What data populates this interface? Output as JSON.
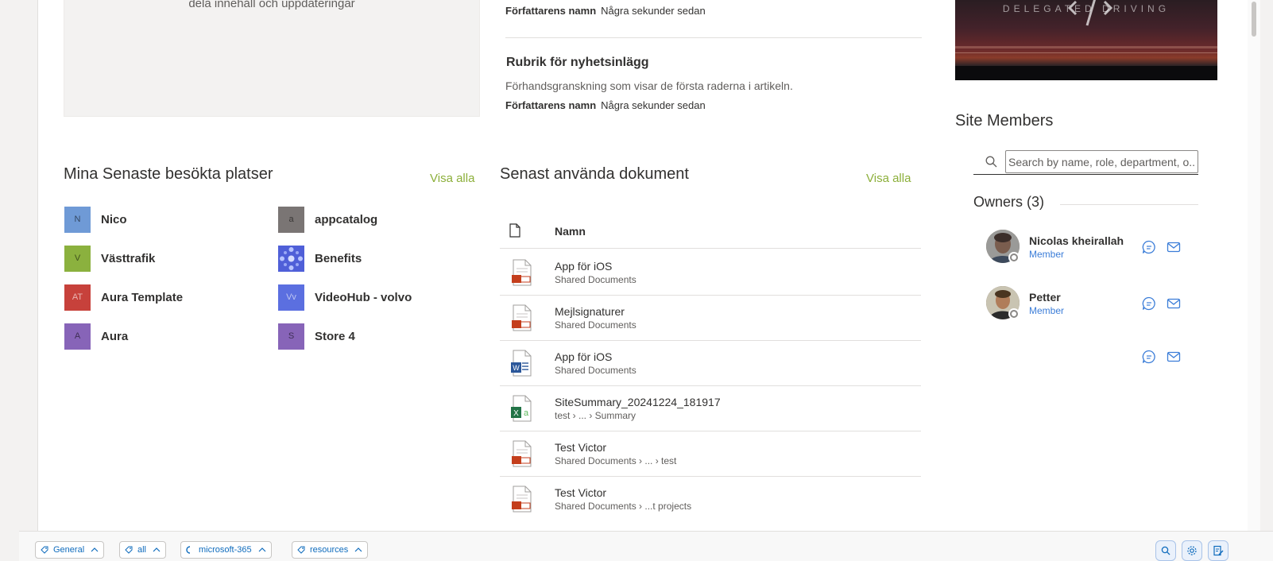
{
  "placeholder": {
    "text": "dela innehåll och uppdateringar"
  },
  "news": {
    "item1": {
      "author": "Författarens namn",
      "time": "Några sekunder sedan"
    },
    "item2": {
      "title": "Rubrik för nyhetsinlägg",
      "preview": "Förhandsgranskning som visar de första raderna i artikeln.",
      "author": "Författarens namn",
      "time": "Några sekunder sedan"
    }
  },
  "hero": {
    "text": "DELEGATED DRIVING"
  },
  "recent_sites": {
    "title": "Mina Senaste besökta platser",
    "see_all": "Visa alla",
    "items": [
      {
        "initials": "N",
        "name": "Nico",
        "color": "#6f9ad6"
      },
      {
        "initials": "a",
        "name": "appcatalog",
        "color": "#7a7574"
      },
      {
        "initials": "V",
        "name": "Västtrafik",
        "color": "#8bb13e"
      },
      {
        "initials": "",
        "name": "Benefits",
        "color": "#4f5fd8"
      },
      {
        "initials": "AT",
        "name": "Aura Template",
        "color": "#c7413b"
      },
      {
        "initials": "Vv",
        "name": "VideoHub - volvo",
        "color": "#5b6fe0"
      },
      {
        "initials": "A",
        "name": "Aura",
        "color": "#8764b8"
      },
      {
        "initials": "S",
        "name": "Store 4",
        "color": "#8764b8"
      }
    ]
  },
  "recent_docs": {
    "title": "Senast använda dokument",
    "see_all": "Visa alla",
    "column_name": "Namn",
    "rows": [
      {
        "name": "App för iOS",
        "path": "Shared Documents",
        "type": "ppt"
      },
      {
        "name": "Mejlsignaturer",
        "path": "Shared Documents",
        "type": "ppt"
      },
      {
        "name": "App för iOS",
        "path": "Shared Documents",
        "type": "word"
      },
      {
        "name": "SiteSummary_20241224_181917",
        "path": "test › ... › Summary",
        "type": "excel"
      },
      {
        "name": "Test Victor",
        "path": "Shared Documents › ... › test",
        "type": "ppt"
      },
      {
        "name": "Test Victor",
        "path": "Shared Documents › ...t projects",
        "type": "ppt"
      }
    ]
  },
  "members": {
    "title": "Site Members",
    "search_placeholder": "Search by name, role, department, o...",
    "owners_title": "Owners (3)",
    "owners": [
      {
        "name": "Nicolas kheirallah",
        "role": "Member"
      },
      {
        "name": "Petter",
        "role": "Member"
      },
      {
        "name": "",
        "role": ""
      }
    ]
  },
  "bottom_bar": {
    "chips": [
      "General",
      "all",
      "microsoft-365",
      "resources"
    ]
  },
  "colors": {
    "link_green": "#8caf3a",
    "role_blue": "#3b7dd8",
    "chip_blue": "#0f6cbd"
  }
}
